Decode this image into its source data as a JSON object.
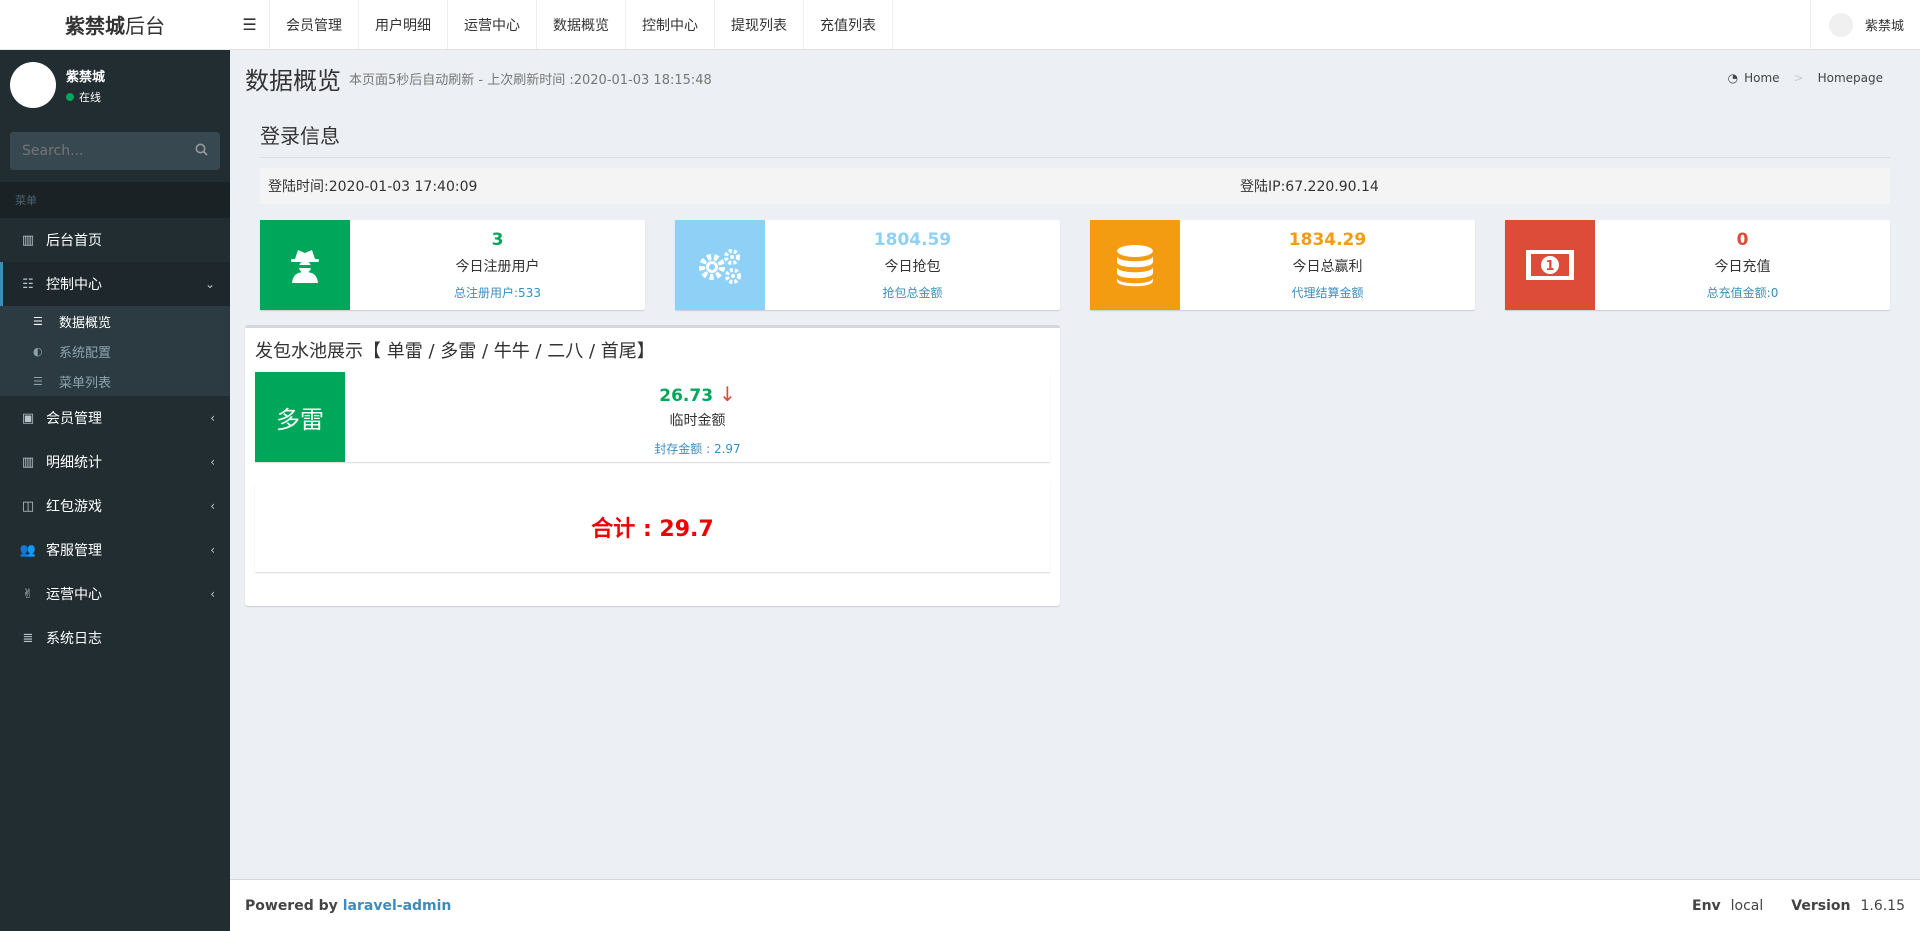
{
  "app": {
    "brand_bold": "紫禁城",
    "brand_rest": " 后台"
  },
  "topnav": {
    "items": [
      "会员管理",
      "用户明细",
      "运营中心",
      "数据概览",
      "控制中心",
      "提现列表",
      "充值列表"
    ],
    "user": "紫禁城"
  },
  "sidebar": {
    "user_name": "紫禁城",
    "user_status": "在线",
    "search_placeholder": "Search...",
    "header": "菜单",
    "items": [
      {
        "label": "后台首页",
        "icon": "bar-chart-icon"
      },
      {
        "label": "控制中心",
        "icon": "tasks-icon",
        "active": true
      },
      {
        "label": "会员管理",
        "icon": "vimeo-icon"
      },
      {
        "label": "明细统计",
        "icon": "bar-chart-icon"
      },
      {
        "label": "红包游戏",
        "icon": "object-group-icon"
      },
      {
        "label": "客服管理",
        "icon": "users-icon"
      },
      {
        "label": "运营中心",
        "icon": "hand-peace-icon"
      },
      {
        "label": "系统日志",
        "icon": "database-icon"
      }
    ],
    "submenu": [
      {
        "label": "数据概览",
        "active": true
      },
      {
        "label": "系统配置"
      },
      {
        "label": "菜单列表"
      }
    ]
  },
  "page": {
    "title": "数据概览",
    "subtitle": "本页面5秒后自动刷新 - 上次刷新时间 :2020-01-03 18:15:48",
    "breadcrumb_home": "Home",
    "breadcrumb_current": "Homepage"
  },
  "login": {
    "section_title": "登录信息",
    "time": "登陆时间:2020-01-03 17:40:09",
    "ip": "登陆IP:67.220.90.14"
  },
  "stats": [
    {
      "value": "3",
      "label": "今日注册用户",
      "sub": "总注册用户:533",
      "color": "#00a65a",
      "icon": "user-secret-icon"
    },
    {
      "value": "1804.59",
      "label": "今日抢包",
      "sub": "抢包总金额",
      "color": "#8fd0f7",
      "icon": "gears-icon"
    },
    {
      "value": "1834.29",
      "label": "今日总赢利",
      "sub": "代理结算金额",
      "color": "#f39c12",
      "icon": "database-icon"
    },
    {
      "value": "0",
      "label": "今日充值",
      "sub": "总充值金额:0",
      "color": "#dd4b39",
      "icon": "money-icon"
    }
  ],
  "pool": {
    "title": "发包水池展示【 单雷 / 多雷 / 牛牛 / 二八 / 首尾】",
    "box_label": "多雷",
    "value": "26.73",
    "arrow": "↓",
    "value_label": "临时金额",
    "sub": "封存金额 : 2.97",
    "total": "合计 : 29.7"
  },
  "footer": {
    "powered": "Powered by",
    "link": "laravel-admin",
    "env_label": "Env",
    "env_value": "local",
    "version_label": "Version",
    "version_value": "1.6.15"
  }
}
